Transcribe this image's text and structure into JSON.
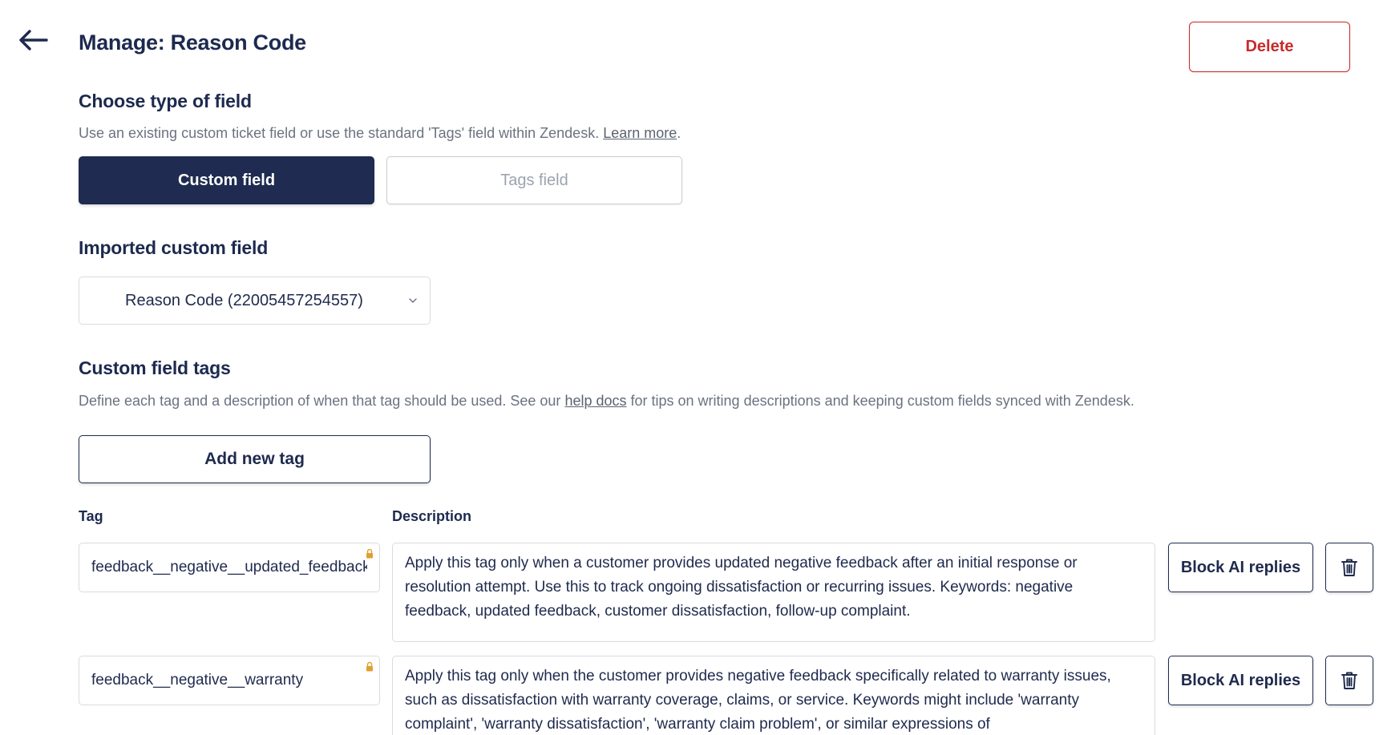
{
  "header": {
    "title": "Manage: Reason Code",
    "back_icon": "arrow-left-icon",
    "delete_label": "Delete"
  },
  "field_type": {
    "title": "Choose type of field",
    "description_prefix": "Use an existing custom ticket field or use the standard 'Tags' field within Zendesk.",
    "learn_more_label": "Learn more",
    "description_suffix": ".",
    "options": [
      {
        "label": "Custom field",
        "selected": true
      },
      {
        "label": "Tags field",
        "selected": false
      }
    ]
  },
  "imported_field": {
    "title": "Imported custom field",
    "selected_value": "Reason Code (22005457254557)"
  },
  "custom_tags": {
    "title": "Custom field tags",
    "description_prefix": "Define each tag and a description of when that tag should be used. See our",
    "help_docs_label": "help docs",
    "description_suffix": "for tips on writing descriptions and keeping custom fields synced with Zendesk.",
    "add_label": "Add new tag",
    "columns": {
      "tag": "Tag",
      "description": "Description"
    },
    "rows": [
      {
        "tag": "feedback__negative__updated_feedback",
        "description": "Apply this tag only when a customer provides updated negative feedback after an initial response or resolution attempt. Use this to track ongoing dissatisfaction or recurring issues. Keywords: negative feedback, updated feedback, customer dissatisfaction, follow-up complaint.",
        "block_label": "Block AI replies"
      },
      {
        "tag": "feedback__negative__warranty",
        "description": "Apply this tag only when the customer provides negative feedback specifically related to warranty issues, such as dissatisfaction with warranty coverage, claims, or service. Keywords might include 'warranty complaint', 'warranty dissatisfaction', 'warranty claim problem', or similar expressions of",
        "block_label": "Block AI replies"
      }
    ]
  },
  "colors": {
    "primary": "#1f2b50",
    "danger": "#c92a2a",
    "lock": "#e0a030",
    "muted_text": "#6b7280"
  }
}
